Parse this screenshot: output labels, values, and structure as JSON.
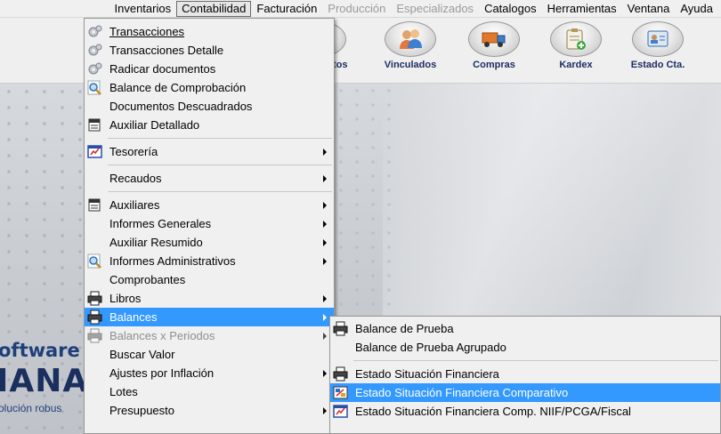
{
  "menubar": {
    "items": [
      {
        "label": "Inventarios",
        "state": "normal"
      },
      {
        "label": "Contabilidad",
        "state": "open"
      },
      {
        "label": "Facturación",
        "state": "normal"
      },
      {
        "label": "Producción",
        "state": "disabled"
      },
      {
        "label": "Especializados",
        "state": "disabled"
      },
      {
        "label": "Catalogos",
        "state": "normal"
      },
      {
        "label": "Herramientas",
        "state": "normal"
      },
      {
        "label": "Ventana",
        "state": "normal"
      },
      {
        "label": "Ayuda",
        "state": "normal"
      }
    ]
  },
  "toolbar": {
    "partial_label": "tos",
    "buttons": [
      {
        "label": "Vinculados",
        "icon": "people-icon"
      },
      {
        "label": "Compras",
        "icon": "truck-icon"
      },
      {
        "label": "Kardex",
        "icon": "clipboard-add-icon"
      },
      {
        "label": "Estado Cta.",
        "icon": "id-card-icon"
      }
    ]
  },
  "background": {
    "brand_top": "oftware",
    "brand_big": "IANA",
    "brand_sub": "olución robus"
  },
  "contabilidad_menu": {
    "items": [
      {
        "label": "Transacciones",
        "icon": "gears-icon"
      },
      {
        "label": "Transacciones Detalle",
        "icon": "gears-icon"
      },
      {
        "label": "Radicar documentos",
        "icon": "gears-icon"
      },
      {
        "label": "Balance de Comprobación",
        "icon": "magnifier-icon"
      },
      {
        "label": "Documentos Descuadrados",
        "icon": ""
      },
      {
        "label": "Auxiliar Detallado",
        "icon": "ledger-icon"
      },
      {
        "separator": true
      },
      {
        "label": "Tesorería",
        "icon": "report-icon",
        "submenu": true
      },
      {
        "separator": true
      },
      {
        "label": "Recaudos",
        "icon": "",
        "submenu": true
      },
      {
        "separator": true
      },
      {
        "label": "Auxiliares",
        "icon": "ledger-icon",
        "submenu": true
      },
      {
        "label": "Informes Generales",
        "icon": "",
        "submenu": true
      },
      {
        "label": "Auxiliar Resumido",
        "icon": "",
        "submenu": true
      },
      {
        "label": "Informes Administrativos",
        "icon": "magnifier-icon",
        "submenu": true
      },
      {
        "label": "Comprobantes",
        "icon": ""
      },
      {
        "label": "Libros",
        "icon": "printer-icon",
        "submenu": true
      },
      {
        "label": "Balances",
        "icon": "printer-icon",
        "submenu": true,
        "highlighted": true
      },
      {
        "label": "Balances x Periodos",
        "icon": "printer-icon",
        "submenu": true,
        "disabled": true
      },
      {
        "label": "Buscar Valor",
        "icon": ""
      },
      {
        "label": "Ajustes por Inflación",
        "icon": "",
        "submenu": true
      },
      {
        "label": "Lotes",
        "icon": ""
      },
      {
        "label": "Presupuesto",
        "icon": "",
        "submenu": true
      }
    ]
  },
  "balances_menu": {
    "items": [
      {
        "label": "Balance de Prueba",
        "icon": "printer-icon"
      },
      {
        "label": "Balance de Prueba Agrupado",
        "icon": ""
      },
      {
        "separator": true
      },
      {
        "label": "Estado Situación Financiera",
        "icon": "printer-icon"
      },
      {
        "label": "Estado Situación Financiera Comparativo",
        "icon": "compare-icon",
        "highlighted": true
      },
      {
        "label": "Estado Situación Financiera Comp. NIIF/PCGA/Fiscal",
        "icon": "report-icon"
      }
    ]
  },
  "colors": {
    "highlight": "#3399ff",
    "menu_bg": "#f0f0f0",
    "toolbar_label": "#1b2f63",
    "brand": "#1f3f7a"
  }
}
